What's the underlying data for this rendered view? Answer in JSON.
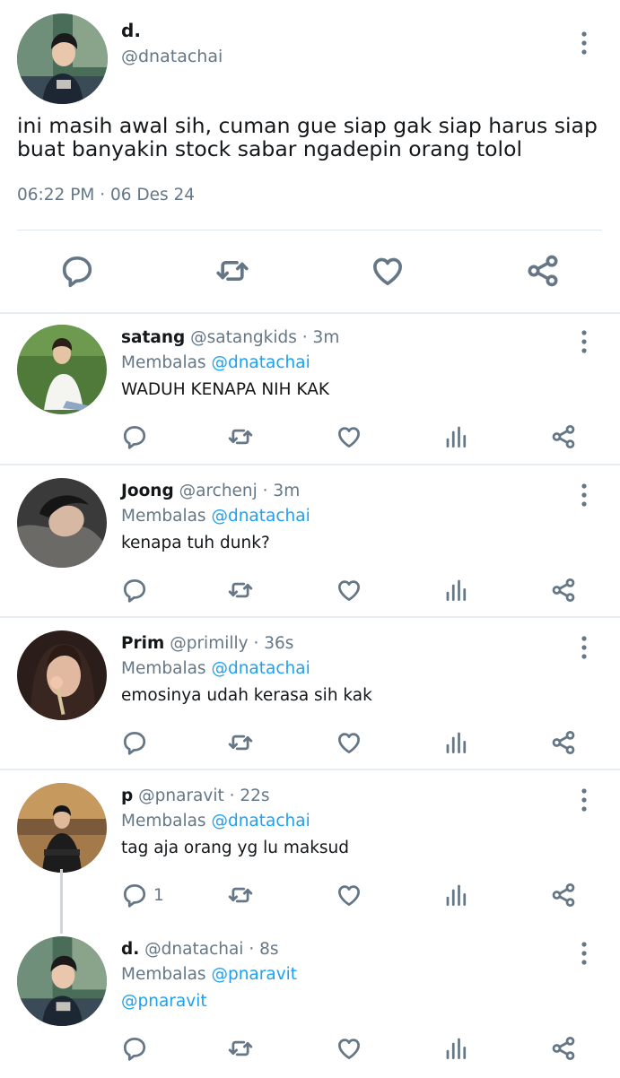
{
  "main_tweet": {
    "author_name": "d.",
    "author_handle": "@dnatachai",
    "text": "ini masih awal sih, cuman gue siap gak siap harus siap buat banyakin stock sabar ngadepin orang tolol",
    "timestamp": "06:22 PM · 06 Des 24",
    "actions": [
      "reply-icon",
      "retweet-icon",
      "like-icon",
      "share-icon"
    ]
  },
  "replies": [
    {
      "name": "satang",
      "meta": "@satangkids · 3m",
      "replying_prefix": "Membalas ",
      "replying_to": "@dnatachai",
      "text": "WADUH KENAPA NIH KAK",
      "reply_count": ""
    },
    {
      "name": "Joong",
      "meta": "@archenj · 3m",
      "replying_prefix": "Membalas ",
      "replying_to": "@dnatachai",
      "text": "kenapa tuh dunk?",
      "reply_count": ""
    },
    {
      "name": "Prim",
      "meta": "@primilly · 36s",
      "replying_prefix": "Membalas ",
      "replying_to": "@dnatachai",
      "text": "emosinya udah kerasa sih kak",
      "reply_count": ""
    },
    {
      "name": "p",
      "meta": "@pnaravit · 22s",
      "replying_prefix": "Membalas ",
      "replying_to": "@dnatachai",
      "text": "tag aja orang yg lu maksud",
      "reply_count": "1"
    },
    {
      "name": "d.",
      "meta": "@dnatachai · 8s",
      "replying_prefix": "Membalas ",
      "replying_to": "@pnaravit",
      "text": "@pnaravit",
      "reply_count": ""
    }
  ],
  "colors": {
    "text": "#14171a",
    "secondary": "#657786",
    "link": "#1da1f2",
    "divider": "#e6ecf0"
  }
}
